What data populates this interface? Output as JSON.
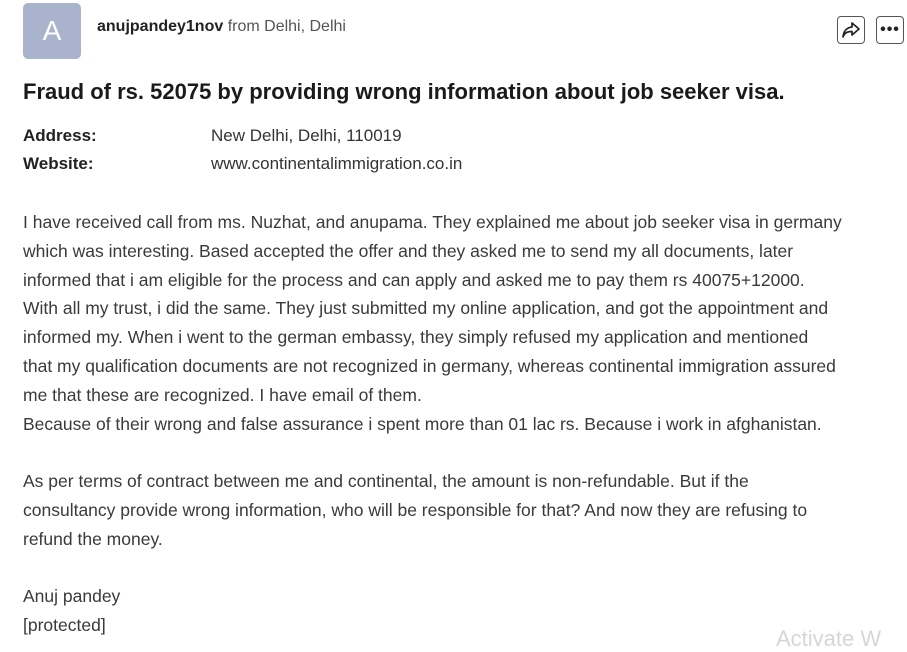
{
  "author": {
    "avatar_letter": "A",
    "username": "anujpandey1nov",
    "location": "from Delhi, Delhi"
  },
  "actions": {
    "share_icon": "share-icon",
    "more_label": "•••"
  },
  "complaint": {
    "title": "Fraud of rs. 52075 by providing wrong information about job seeker visa.",
    "address_label": "Address:",
    "address_value": "New Delhi, Delhi, 110019",
    "website_label": "Website:",
    "website_value": "www.continentalimmigration.co.in",
    "body_lines": [
      "I have received call from ms. Nuzhat, and anupama. They explained me about job seeker visa in germany",
      "which was interesting. Based accepted the offer and they asked me to send my all documents, later",
      "informed that i am eligible for the process and can apply and asked me to pay them rs 40075+12000.",
      "With all my trust, i did the same. They just submitted my online application, and got the appointment and",
      "informed my. When i went to the german embassy, they simply refused my application and mentioned",
      "that my qualification documents are not recognized in germany, whereas continental immigration assured",
      "me that these are recognized. I have email of them.",
      "Because of their wrong and false assurance i spent more than 01 lac rs. Because i work in afghanistan.",
      "",
      "As per terms of contract between me and continental, the amount is non-refundable. But if the",
      "consultancy provide wrong information, who will be responsible for that? And now they are refusing to",
      "refund the money.",
      "",
      "Anuj pandey",
      "[protected]"
    ]
  },
  "watermark": "Activate W"
}
